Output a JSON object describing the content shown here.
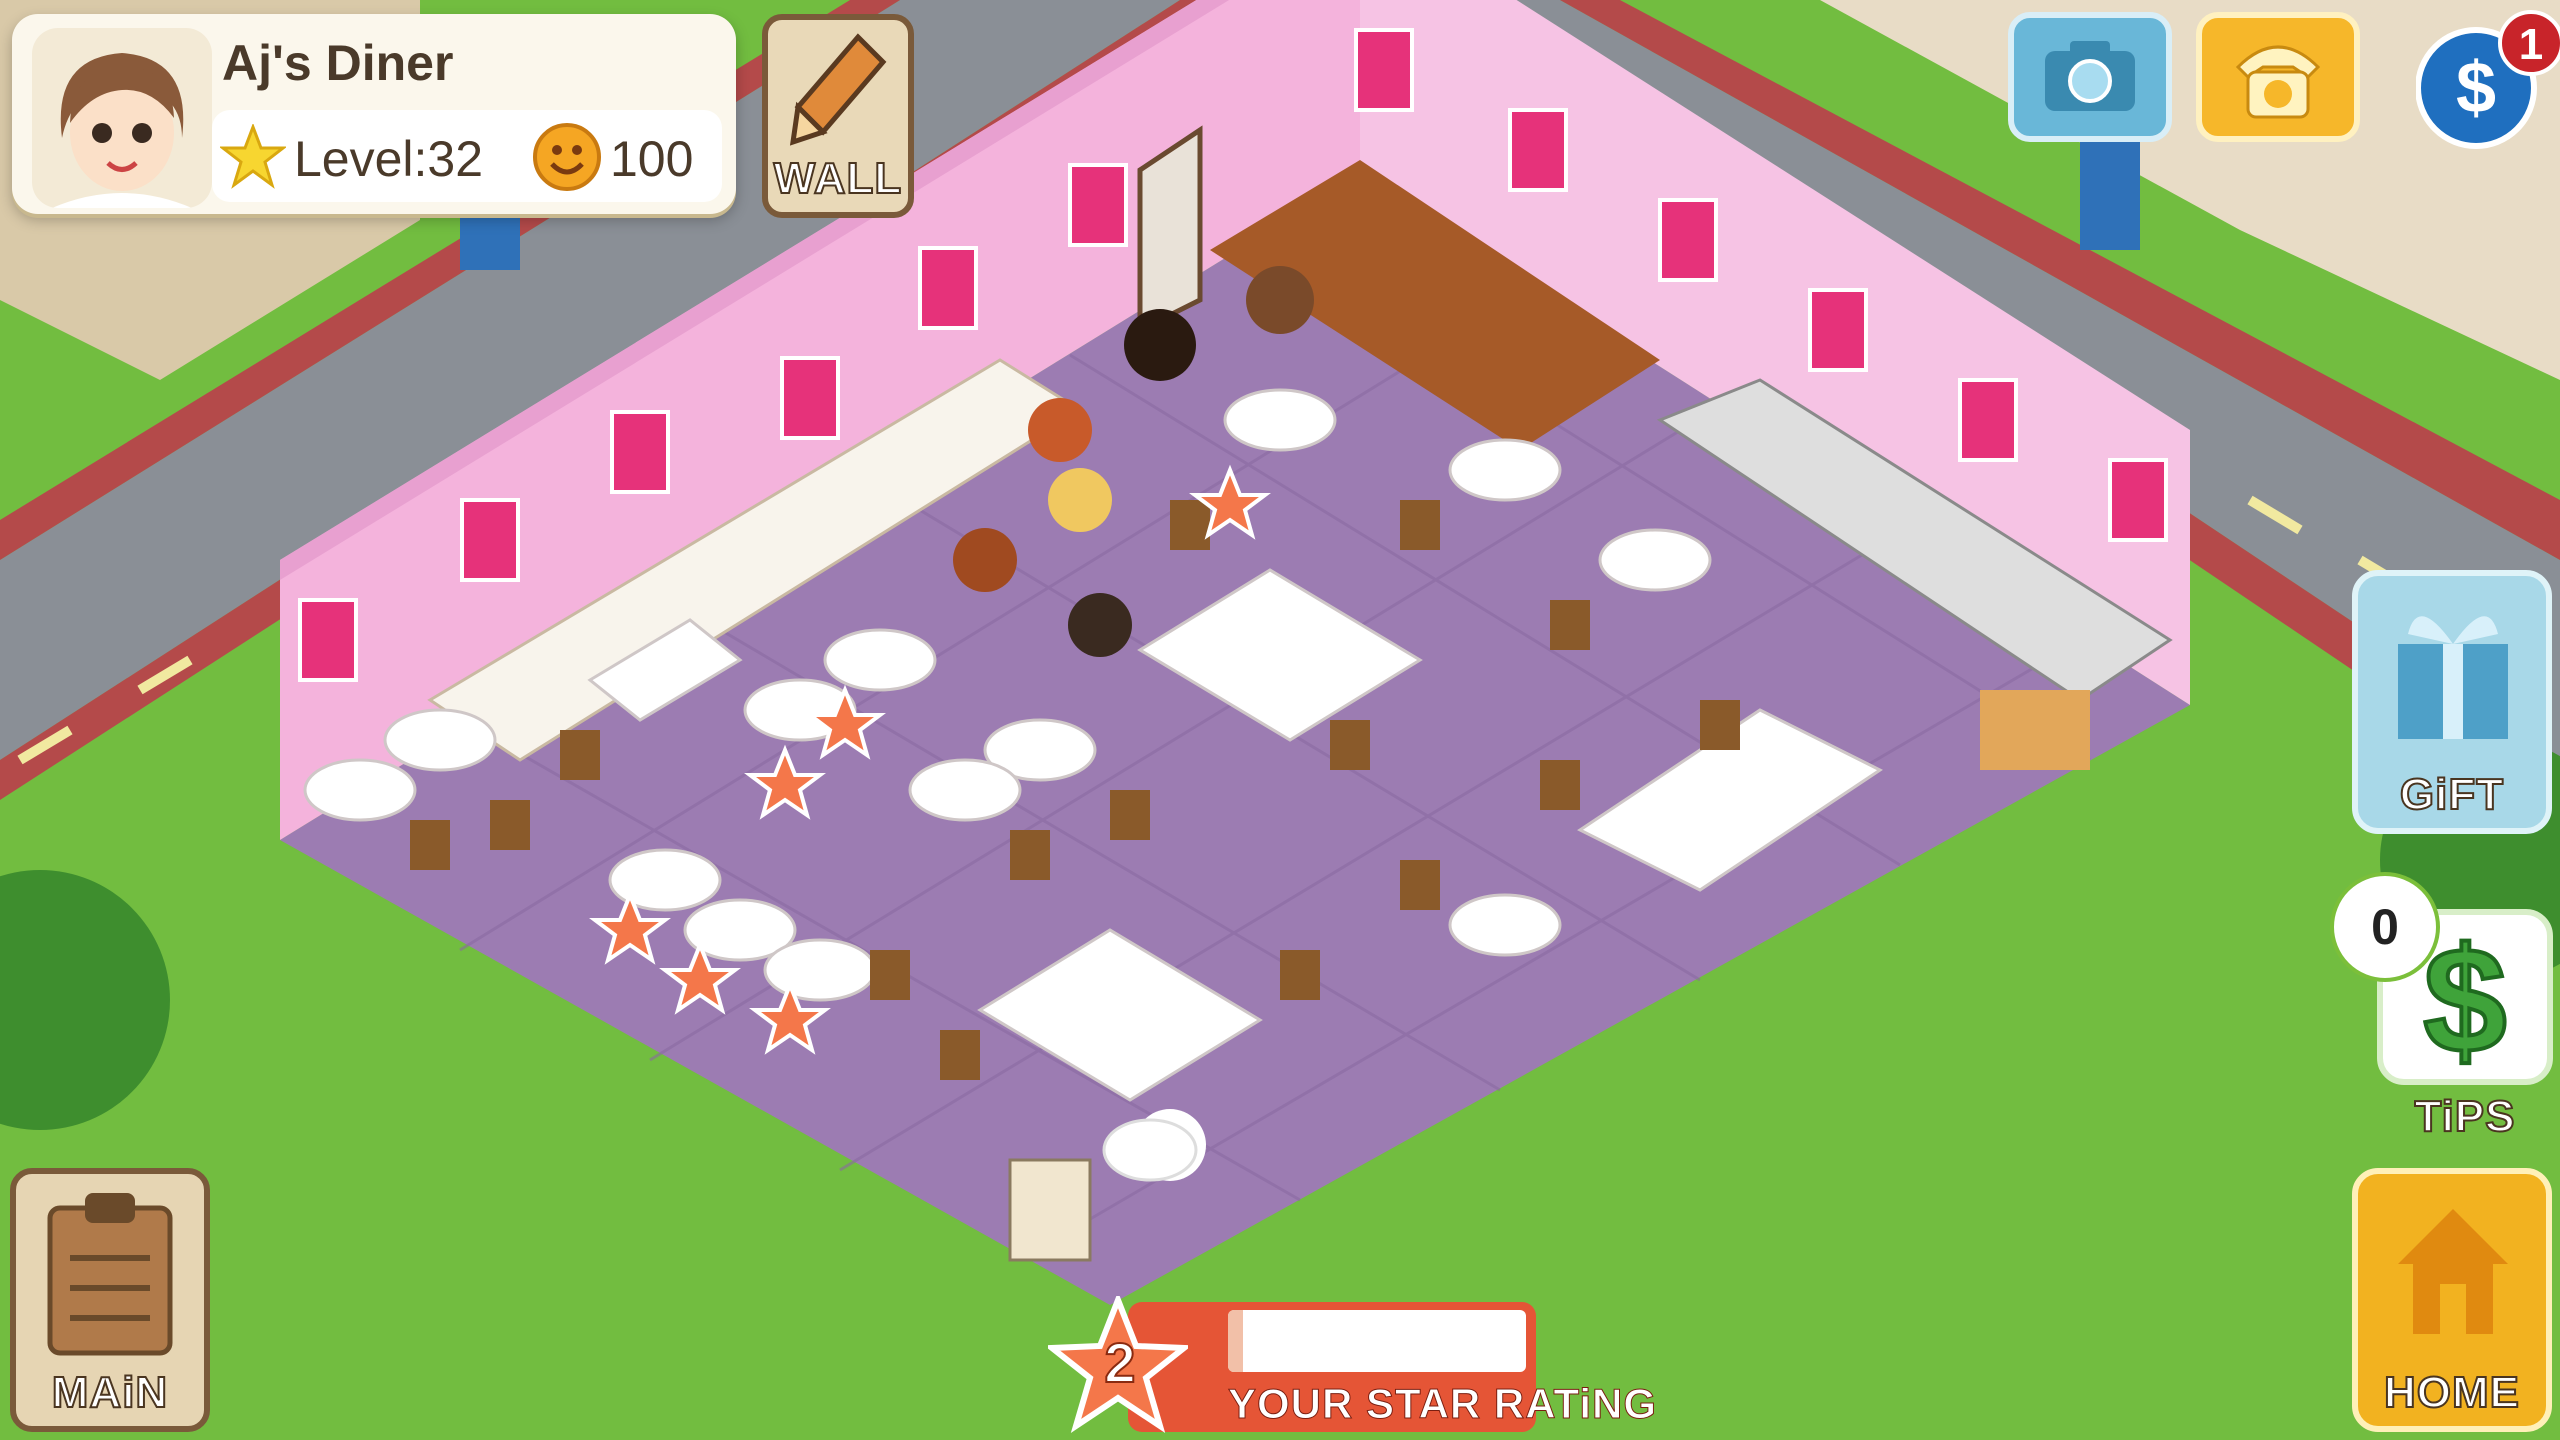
{
  "profile": {
    "diner_name": "Aj's Diner",
    "level_text": "Level:32",
    "coins": "100",
    "avatar_icon": "chef-avatar"
  },
  "buttons": {
    "wall": "WALL",
    "gift": "GiFT",
    "tips": "TiPS",
    "home": "HOME",
    "main": "MAiN"
  },
  "notifications": {
    "count": "1"
  },
  "tips": {
    "count": "0"
  },
  "star_rating": {
    "stars": "2",
    "label": "YOUR STAR RATiNG",
    "progress": 0.05
  },
  "colors": {
    "grass": "#6fba3f",
    "wall_pink": "#f2a9d6",
    "floor_purple": "#9a78b0",
    "accent_red": "#e55536",
    "accent_yellow": "#f2b220"
  }
}
